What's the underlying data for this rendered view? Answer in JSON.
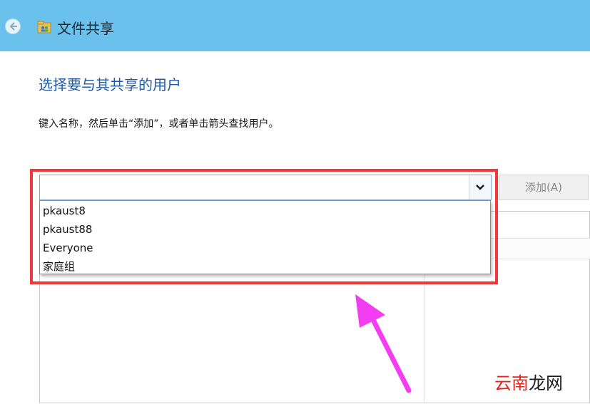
{
  "header": {
    "title": "文件共享",
    "back_icon": "back-arrow-icon",
    "app_icon": "share-folder-icon",
    "bg_color": "#6ac2ec"
  },
  "main": {
    "heading": "选择要与其共享的用户",
    "instruction": "键入名称，然后单击“添加”，或者单击箭头查找用户。",
    "user_input": {
      "value": "",
      "placeholder": ""
    },
    "add_button_label": "添加(A)",
    "dropdown_options": [
      "pkaust8",
      "pkaust88",
      "Everyone",
      "家庭组"
    ]
  },
  "annotation": {
    "highlight_color": "#f2383a",
    "arrow_color": "#f23ef0"
  },
  "watermark": {
    "part1": "云南",
    "part2": "龙网"
  },
  "colors": {
    "heading": "#1e5aa8",
    "watermark_red": "#e8231c",
    "watermark_dark": "#1c1c1c"
  }
}
